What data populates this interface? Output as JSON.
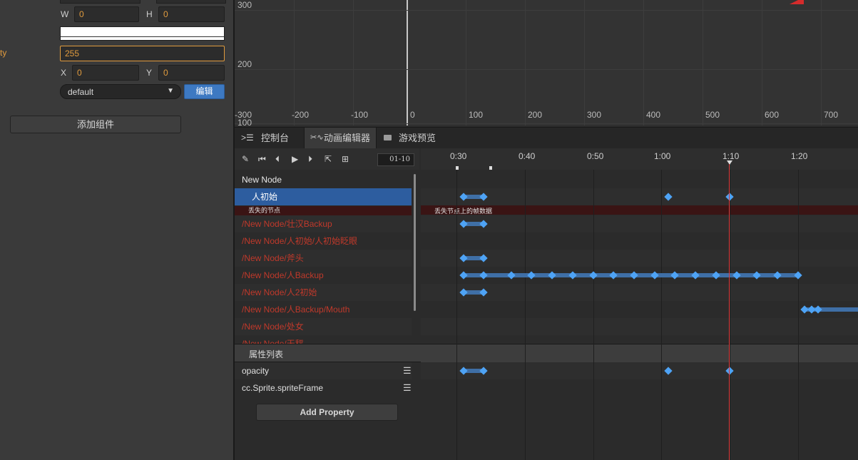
{
  "inspector": {
    "w_label": "W",
    "w_value": "0",
    "h_label": "H",
    "h_value": "0",
    "opacity_label": "ty",
    "opacity_value": "255",
    "x_label": "X",
    "x_value": "0",
    "y_label": "Y",
    "y_value": "0",
    "select_value": "default",
    "edit_button": "编辑",
    "add_component": "添加组件"
  },
  "scene": {
    "y_labels": [
      "300",
      "200",
      "100"
    ],
    "x_labels": [
      "-300",
      "-200",
      "-100",
      "0",
      "100",
      "200",
      "300",
      "400",
      "500",
      "600",
      "700"
    ]
  },
  "tabs": [
    {
      "label": "控制台",
      "icon": "terminal-icon"
    },
    {
      "label": "动画编辑器",
      "icon": "animation-icon"
    },
    {
      "label": "游戏预览",
      "icon": "camera-icon"
    }
  ],
  "toolbar": {
    "frame_value": "01-10"
  },
  "timeline": {
    "ticks": [
      "0:30",
      "0:40",
      "0:50",
      "1:00",
      "1:10",
      "1:20"
    ],
    "missing_frames_label": "丢失节点上的帧数据"
  },
  "nodes": {
    "root": "New Node",
    "selected": "人初始",
    "missing_label": "丢失的节点",
    "items": [
      "/New Node/壮汉Backup",
      "/New Node/人初始/人初始眨眼",
      "/New Node/斧头",
      "/New Node/人Backup",
      "/New Node/人2初始",
      "/New Node/人Backup/Mouth",
      "/New Node/处女",
      "/New Node/天秤"
    ]
  },
  "properties": {
    "header": "属性列表",
    "items": [
      "opacity",
      "cc.Sprite.spriteFrame"
    ],
    "add_button": "Add Property"
  },
  "colors": {
    "accent": "#4ea3f5",
    "selected_row": "#2d5d9f",
    "missing": "#c0392b",
    "playhead": "#e03a3a"
  }
}
